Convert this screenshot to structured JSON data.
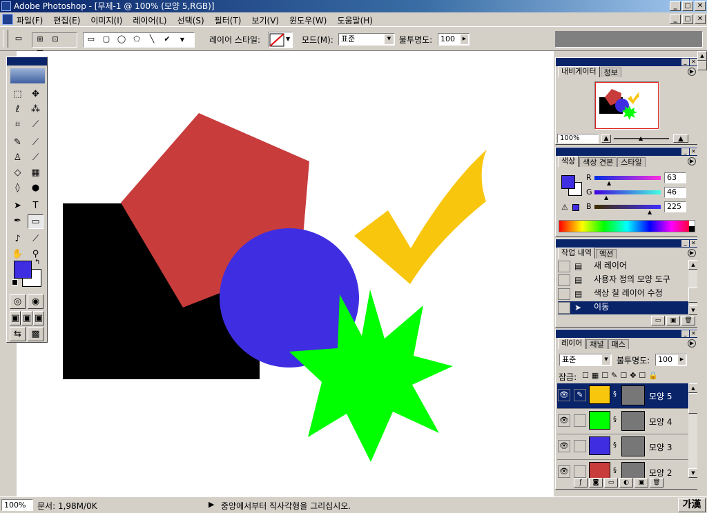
{
  "window": {
    "title": "Adobe Photoshop - [무제-1 @ 100% (모양 5,RGB)]",
    "controls": [
      "_",
      "▢",
      "✕"
    ]
  },
  "menu": [
    "파일(F)",
    "편집(E)",
    "이미지(I)",
    "레이어(L)",
    "선택(S)",
    "필터(T)",
    "보기(V)",
    "윈도우(W)",
    "도움말(H)"
  ],
  "options": {
    "layer_style_label": "레이어 스타일:",
    "mode_label": "모드(M):",
    "mode_value": "표준",
    "opacity_label": "불투명도:",
    "opacity_value": "100"
  },
  "navigator": {
    "tabs": [
      "내비게이터",
      "정보"
    ],
    "zoom": "100%"
  },
  "color": {
    "tabs": [
      "색상",
      "색상 견본",
      "스타일"
    ],
    "r_label": "R",
    "r_value": "63",
    "g_label": "G",
    "g_value": "46",
    "b_label": "B",
    "b_value": "225",
    "foreground": "#3f2ee1"
  },
  "history": {
    "tabs": [
      "작업 내역",
      "액션"
    ],
    "items": [
      {
        "label": "새 레이어"
      },
      {
        "label": "사용자 정의 모양 도구"
      },
      {
        "label": "색상 칠 레이어 수정"
      },
      {
        "label": "이동"
      }
    ]
  },
  "layers": {
    "tabs": [
      "레이어",
      "채널",
      "패스"
    ],
    "mode_value": "표준",
    "opacity_label": "불투명도:",
    "opacity_value": "100",
    "lock_label": "잠금:",
    "items": [
      {
        "name": "모양 5",
        "color": "#f9c60e"
      },
      {
        "name": "모양 4",
        "color": "#00ff00"
      },
      {
        "name": "모양 3",
        "color": "#3f2ee1"
      },
      {
        "name": "모양 2",
        "color": "#c83c3c"
      }
    ]
  },
  "status": {
    "zoom": "100%",
    "doc_info": "문서: 1,98M/0K",
    "hint": "중앙에서부터 직사각형을 그리십시오.",
    "ime": "가漢"
  },
  "shapes": {
    "black_rect": "#000000",
    "pentagon": "#c83c3c",
    "circle": "#3f2ee1",
    "star": "#00ff00",
    "check": "#f9c60e"
  }
}
